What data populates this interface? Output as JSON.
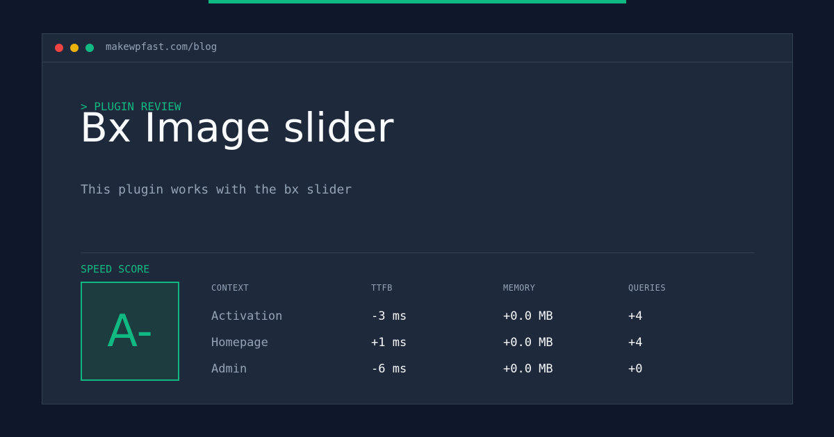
{
  "window": {
    "url": "makewpfast.com/blog",
    "controls": {
      "close_color": "#ef4444",
      "minimize_color": "#eab308",
      "maximize_color": "#10b981"
    }
  },
  "article": {
    "eyebrow": "> PLUGIN REVIEW",
    "title": "Bx Image slider",
    "description": "This plugin works with the bx slider"
  },
  "speed": {
    "label": "SPEED SCORE",
    "grade": "A-"
  },
  "table": {
    "headers": [
      "CONTEXT",
      "TTFB",
      "MEMORY",
      "QUERIES"
    ],
    "rows": [
      [
        "Activation",
        "-3 ms",
        "+0.0 MB",
        "+4"
      ],
      [
        "Homepage",
        "+1 ms",
        "+0.0 MB",
        "+4"
      ],
      [
        "Admin",
        "-6 ms",
        "+0.0 MB",
        "+0"
      ]
    ]
  },
  "colors": {
    "background": "#0f172a",
    "panel": "#1e293b",
    "accent": "#10b981",
    "muted_text": "#94a3b8",
    "primary_text": "#f8fafc"
  }
}
